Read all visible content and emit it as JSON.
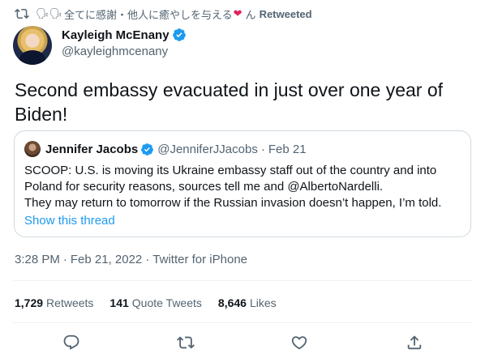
{
  "retweet_bar": {
    "emoji": "🗣🗣",
    "retweeter_name": "全てに感謝・他人に癒やしを与える",
    "heart": "❤",
    "suffix": "ん",
    "label": "Retweeted"
  },
  "author": {
    "name": "Kayleigh McEnany",
    "handle": "@kayleighmcenany"
  },
  "tweet": {
    "text": "Second embassy evacuated in just over one year of\nBiden!"
  },
  "quote": {
    "name": "Jennifer Jacobs",
    "handle": "@JenniferJJacobs",
    "separator": "·",
    "date": "Feb 21",
    "lines": [
      "SCOOP: U.S. is moving its Ukraine embassy staff out of the country and into",
      "Poland for security reasons, sources tell me and @AlbertoNardelli.",
      "They may return to tomorrow if the Russian invasion doesn’t happen, I’m told."
    ],
    "show_thread": "Show this thread"
  },
  "meta": {
    "time": "3:28 PM",
    "date": "Feb 21, 2022",
    "source": "Twitter for iPhone",
    "separator": "·"
  },
  "stats": {
    "retweets_count": "1,729",
    "retweets_label": "Retweets",
    "quotes_count": "141",
    "quotes_label": "Quote Tweets",
    "likes_count": "8,646",
    "likes_label": "Likes"
  },
  "colors": {
    "accent": "#1d9bf0",
    "secondary_text": "#536471",
    "primary_text": "#0f1419",
    "border": "#cfd9de"
  },
  "icons": {
    "retweet_bar": "retweet-icon",
    "verified": "verified-badge-icon",
    "actions": [
      "reply-icon",
      "retweet-icon",
      "like-icon",
      "share-icon"
    ]
  }
}
